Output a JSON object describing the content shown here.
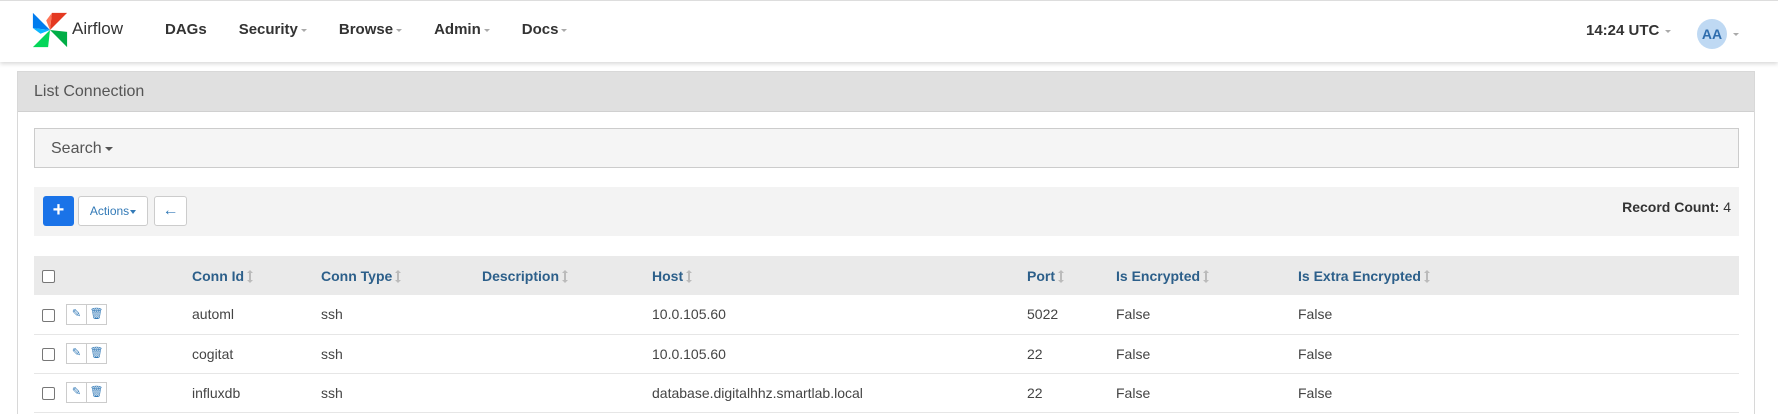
{
  "navbar": {
    "brand": "Airflow",
    "menu": [
      {
        "label": "DAGs",
        "dropdown": false
      },
      {
        "label": "Security",
        "dropdown": true
      },
      {
        "label": "Browse",
        "dropdown": true
      },
      {
        "label": "Admin",
        "dropdown": true
      },
      {
        "label": "Docs",
        "dropdown": true
      }
    ],
    "clock": "14:24 UTC",
    "avatar_initials": "AA"
  },
  "panel": {
    "title": "List Connection",
    "search_label": "Search",
    "toolbar": {
      "add_icon": "plus-icon",
      "actions_label": "Actions",
      "back_icon": "arrow-left-icon",
      "record_count_label": "Record Count:",
      "record_count": "4"
    },
    "table": {
      "columns": [
        "Conn Id",
        "Conn Type",
        "Description",
        "Host",
        "Port",
        "Is Encrypted",
        "Is Extra Encrypted"
      ],
      "rows": [
        {
          "conn_id": "automl",
          "conn_type": "ssh",
          "description": "",
          "host": "10.0.105.60",
          "port": "5022",
          "is_encrypted": "False",
          "is_extra_encrypted": "False"
        },
        {
          "conn_id": "cogitat",
          "conn_type": "ssh",
          "description": "",
          "host": "10.0.105.60",
          "port": "22",
          "is_encrypted": "False",
          "is_extra_encrypted": "False"
        },
        {
          "conn_id": "influxdb",
          "conn_type": "ssh",
          "description": "",
          "host": "database.digitalhhz.smartlab.local",
          "port": "22",
          "is_encrypted": "False",
          "is_extra_encrypted": "False"
        }
      ]
    }
  },
  "colors": {
    "primary": "#1a73e8",
    "header_link": "#2c5f8a",
    "panel_heading_bg": "#e0e0e0",
    "avatar_bg": "#bfd9f3"
  }
}
